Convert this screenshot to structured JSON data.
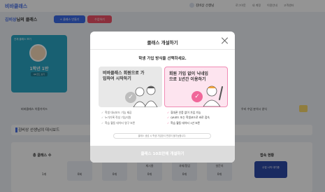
{
  "header": {
    "logo": "비바클래스",
    "user_name": "김비상 선생님",
    "links": [
      "로그아웃",
      "내 계정",
      "이용안내",
      "고객센터"
    ]
  },
  "page": {
    "title_highlight": "김비상",
    "title_suffix": "님의 클래스",
    "new_class_button": "+ 클래스 만들기",
    "join_class_button": "수업하기"
  },
  "class_card": {
    "label": "전체 클래스 보기",
    "title": "1학년 1반",
    "button": "QR코드 보기"
  },
  "guides": {
    "left": "비바클래스 이용가이드",
    "right": "우리 수업 분석시 양식"
  },
  "dashboard_bar": "김비상 선생님의 대시보드",
  "stats": {
    "total_label": "총 클래스 수",
    "total_value": "1개",
    "connection_label": "접속 현황",
    "live_label": "수업 시작 대기중",
    "boxes": [
      {
        "label": "",
        "value": "0회"
      },
      {
        "label": "",
        "value": "0개"
      },
      {
        "label": "제시물",
        "value": "0개"
      },
      {
        "label": "과제/협업",
        "value": "0개"
      },
      {
        "label": "설문지",
        "value": "0개"
      }
    ]
  },
  "modal": {
    "title": "클래스 개설하기",
    "subtitle": "학생 가입 방식을 선택하세요.",
    "option_a": {
      "title": "비바클래스 회원으로 가입하여 시작하기",
      "features": [
        "학생 대시보드 기능 제공",
        "누가기록 작성 기능지원",
        "학습 활동 데이터 영구 보존"
      ]
    },
    "option_b": {
      "title": "회원 가입 없이 닉네임으로 1년간 이용하기",
      "features": [
        "휴대폰 인증 없이 가입 가능",
        "QR코드 또는 학생코드로 바로 접속",
        "학습 활동 데이터 1년 보존"
      ]
    },
    "note": "클래스 생성 시 학생 가입방식 변경이 불가능합니다.",
    "cta": "클래스 10초만에 개설하기"
  }
}
